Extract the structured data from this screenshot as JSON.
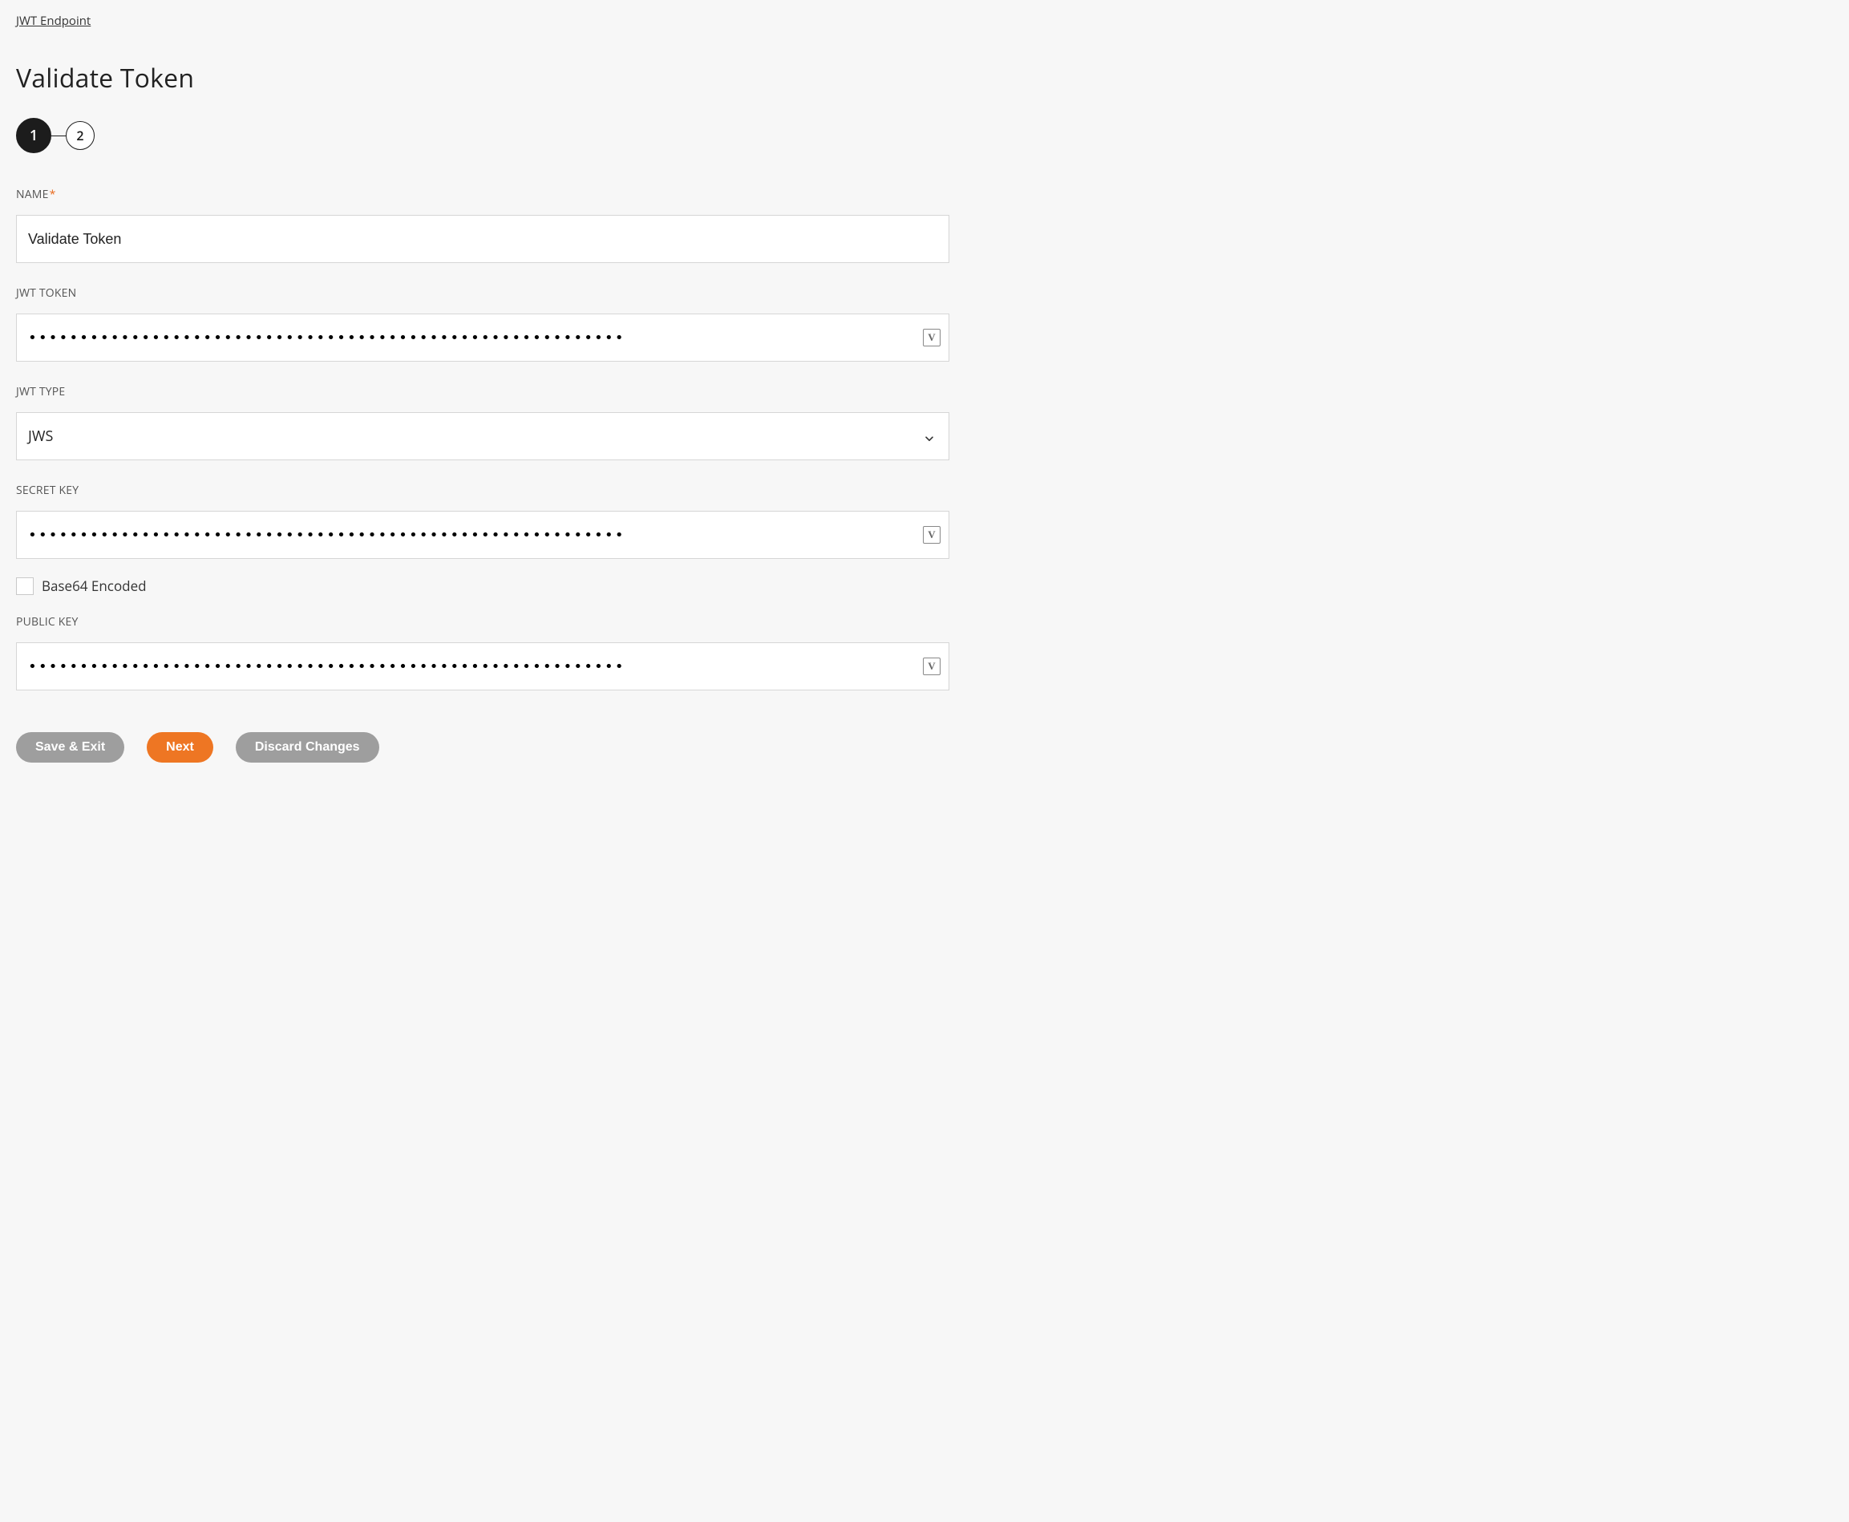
{
  "breadcrumb": "JWT Endpoint",
  "title": "Validate Token",
  "stepper": {
    "step1": "1",
    "step2": "2"
  },
  "fields": {
    "name": {
      "label": "NAME",
      "value": "Validate Token",
      "required": true
    },
    "jwt_token": {
      "label": "JWT TOKEN",
      "masked": "••••••••••••••••••••••••••••••••••••••••••••••••••••••••••",
      "icon": "V"
    },
    "jwt_type": {
      "label": "JWT TYPE",
      "value": "JWS"
    },
    "secret_key": {
      "label": "SECRET KEY",
      "masked": "••••••••••••••••••••••••••••••••••••••••••••••••••••••••••",
      "icon": "V"
    },
    "base64": {
      "label": "Base64 Encoded"
    },
    "public_key": {
      "label": "PUBLIC KEY",
      "masked": "••••••••••••••••••••••••••••••••••••••••••••••••••••••••••",
      "icon": "V"
    }
  },
  "buttons": {
    "save_exit": "Save & Exit",
    "next": "Next",
    "discard": "Discard Changes"
  }
}
